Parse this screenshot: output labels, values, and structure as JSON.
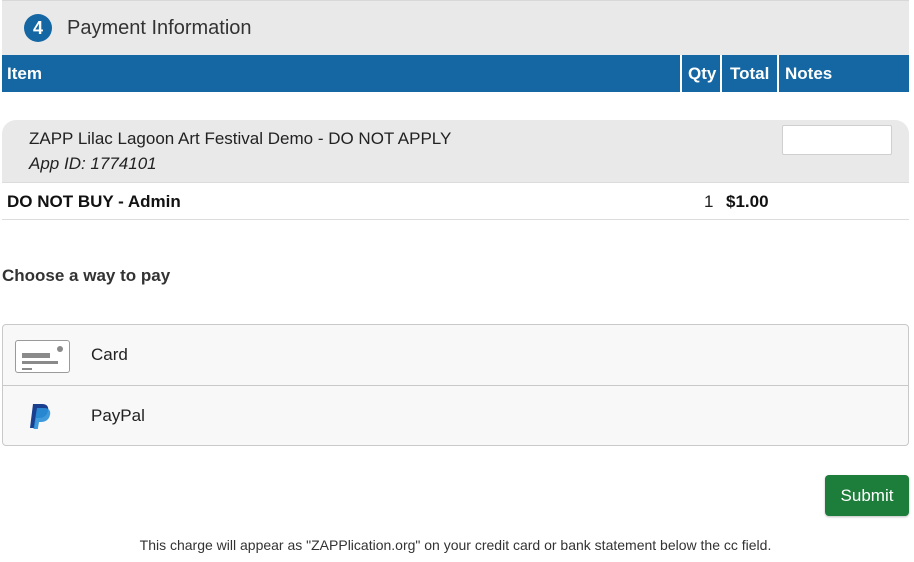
{
  "section": {
    "step_number": "4",
    "title": "Payment Information"
  },
  "table": {
    "headers": {
      "item": "Item",
      "qty": "Qty",
      "total": "Total",
      "notes": "Notes"
    },
    "application": {
      "name": "ZAPP Lilac Lagoon Art Festival Demo - DO NOT APPLY",
      "app_id": "App ID: 1774101",
      "notes_value": ""
    },
    "line_items": [
      {
        "name": "DO NOT BUY - Admin",
        "qty": "1",
        "total": "$1.00"
      }
    ]
  },
  "payment": {
    "prompt": "Choose a way to pay",
    "options": [
      {
        "label": "Card",
        "icon": "credit-card-icon"
      },
      {
        "label": "PayPal",
        "icon": "paypal-icon"
      }
    ]
  },
  "actions": {
    "submit_label": "Submit"
  },
  "footer": {
    "note": "This charge will appear as \"ZAPPlication.org\" on your credit card or bank statement below the cc field."
  },
  "colors": {
    "header_blue": "#1467a2",
    "submit_green": "#1d7d3a",
    "header_gray": "#e9e9ea"
  }
}
